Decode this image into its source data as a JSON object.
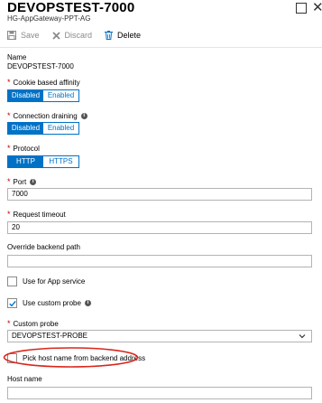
{
  "blade": {
    "title": "DEVOPSTEST-7000",
    "subtitle": "HG-AppGateway-PPT-AG"
  },
  "toolbar": {
    "save_label": "Save",
    "discard_label": "Discard",
    "delete_label": "Delete"
  },
  "form": {
    "name_label": "Name",
    "name_value": "DEVOPSTEST-7000",
    "cookie_label": "Cookie based affinity",
    "cookie_options": [
      "Disabled",
      "Enabled"
    ],
    "cookie_selected": "Disabled",
    "draining_label": "Connection draining",
    "draining_options": [
      "Disabled",
      "Enabled"
    ],
    "draining_selected": "Disabled",
    "protocol_label": "Protocol",
    "protocol_options": [
      "HTTP",
      "HTTPS"
    ],
    "protocol_selected": "HTTP",
    "port_label": "Port",
    "port_value": "7000",
    "timeout_label": "Request timeout",
    "timeout_value": "20",
    "override_path_label": "Override backend path",
    "override_path_value": "",
    "app_service_label": "Use for App service",
    "app_service_checked": false,
    "custom_probe_check_label": "Use custom probe",
    "custom_probe_checked": true,
    "custom_probe_label": "Custom probe",
    "custom_probe_value": "DEVOPSTEST-PROBE",
    "pick_host_label": "Pick host name from backend address",
    "pick_host_checked": false,
    "host_name_label": "Host name",
    "host_name_value": ""
  },
  "colors": {
    "accent": "#0072c6",
    "required": "#c00000",
    "annotation": "#d9261c"
  },
  "icons": [
    "save-icon",
    "discard-icon",
    "delete-icon",
    "maximize-icon",
    "close-icon",
    "info-icon",
    "check-icon",
    "chevron-down-icon"
  ]
}
